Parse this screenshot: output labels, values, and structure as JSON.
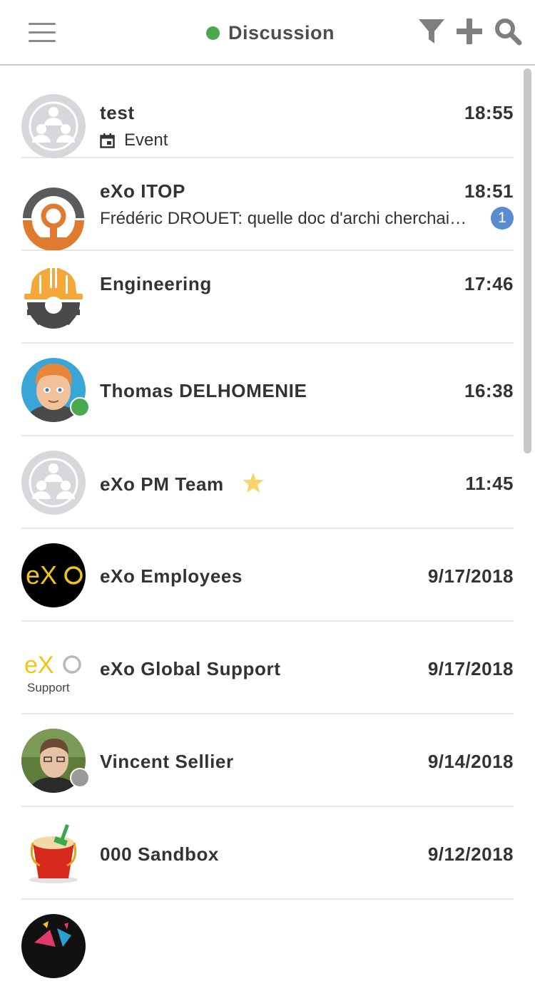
{
  "header": {
    "title": "Discussion",
    "status_color": "#4aa84e",
    "icons": [
      "menu-icon",
      "filter-icon",
      "plus-icon",
      "search-icon"
    ]
  },
  "rooms": [
    {
      "name": "test",
      "time": "18:55",
      "subtitle": "Event",
      "subtitle_icon": "calendar-icon",
      "avatar": "group-placeholder"
    },
    {
      "name": "eXo ITOP",
      "time": "18:51",
      "preview": "Frédéric DROUET: quelle doc d'archi cherchais-tu ?",
      "unread": "1",
      "avatar": "itop-logo"
    },
    {
      "name": "Engineering",
      "time": "17:46",
      "avatar": "engineering-logo"
    },
    {
      "name": "Thomas DELHOMENIE",
      "time": "16:38",
      "avatar": "user-avatar",
      "presence": "online"
    },
    {
      "name": "eXo PM Team",
      "time": "11:45",
      "avatar": "group-placeholder",
      "favorite": true
    },
    {
      "name": "eXo Employees",
      "time": "9/17/2018",
      "avatar": "exo-logo"
    },
    {
      "name": "eXo Global Support",
      "time": "9/17/2018",
      "avatar": "exo-support-logo",
      "avatar_text": "eXo Support"
    },
    {
      "name": "Vincent Sellier",
      "time": "9/14/2018",
      "avatar": "user-photo",
      "presence": "offline"
    },
    {
      "name": "000 Sandbox",
      "time": "9/12/2018",
      "avatar": "sandbox-bucket"
    }
  ]
}
